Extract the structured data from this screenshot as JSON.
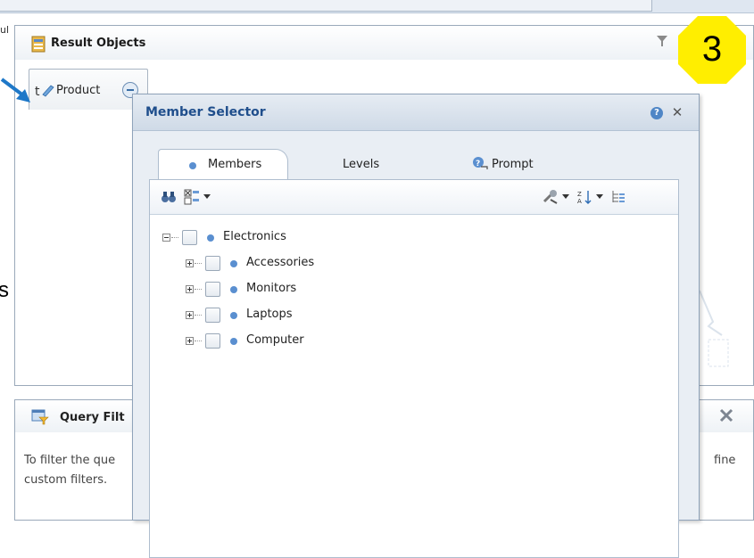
{
  "app": {
    "left_tab_label": "ul",
    "left_cut_letter": "s"
  },
  "result_objects": {
    "title": "Result Objects",
    "product_label": "Product"
  },
  "badge": {
    "number": "3",
    "color": "#ffee00"
  },
  "query_filters": {
    "title": "Query Filt",
    "desc_line1": "To filter the que",
    "desc_line2": "custom filters.",
    "right_text": "fine"
  },
  "member_selector": {
    "title": "Member Selector",
    "help_symbol": "?",
    "close_symbol": "✕",
    "tabs": [
      {
        "label": "Members",
        "active": true
      },
      {
        "label": "Levels",
        "active": false
      },
      {
        "label": "Prompt",
        "active": false
      }
    ],
    "toolbar_icons": [
      "binoculars-icon",
      "select-icon",
      "settings-icon",
      "sort-icon",
      "hierarchy-icon"
    ],
    "tree": {
      "root": {
        "label": "Electronics",
        "expanded": true
      },
      "children": [
        {
          "label": "Accessories"
        },
        {
          "label": "Monitors"
        },
        {
          "label": "Laptops"
        },
        {
          "label": "Computer"
        }
      ]
    }
  },
  "colors": {
    "accent": "#1f4e8c",
    "member_dot": "#5a8fd0",
    "arrow": "#1e78c8"
  }
}
